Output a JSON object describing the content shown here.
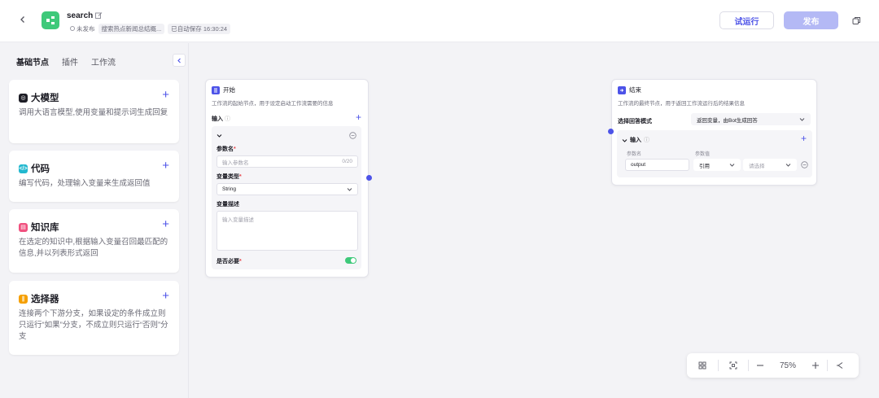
{
  "header": {
    "app_name": "search",
    "status": "未发布",
    "description": "搜索热点新闻总结概...",
    "autosave": "已自动保存 16:30:24",
    "test_run_label": "试运行",
    "publish_label": "发布"
  },
  "sidebar": {
    "tabs": [
      {
        "label": "基础节点"
      },
      {
        "label": "插件"
      },
      {
        "label": "工作流"
      }
    ],
    "nodes": [
      {
        "title": "大模型",
        "desc": "调用大语言模型,使用变量和提示词生成回复",
        "color": "#1d1d25"
      },
      {
        "title": "代码",
        "desc": "编写代码，处理输入变量来生成返回值",
        "color": "#22b8cf"
      },
      {
        "title": "知识库",
        "desc": "在选定的知识中,根据输入变量召回最匹配的信息,并以列表形式返回",
        "color": "#f0517f"
      },
      {
        "title": "选择器",
        "desc": "连接两个下游分支，如果设定的条件成立则只运行“如果”分支，不成立则只运行“否则”分支",
        "color": "#f59f00"
      }
    ]
  },
  "start_node": {
    "title": "开始",
    "desc": "工作流的起始节点，用于设定启动工作流需要的信息",
    "input_label": "输入",
    "param_name_label": "参数名",
    "param_name_placeholder": "输入参数名",
    "param_name_count": "0/20",
    "var_type_label": "变量类型",
    "var_type_value": "String",
    "var_desc_label": "变量描述",
    "var_desc_placeholder": "输入变量描述",
    "required_label": "是否必要"
  },
  "end_node": {
    "title": "结束",
    "desc": "工作流的最终节点，用于返回工作流运行后的结果信息",
    "mode_label": "选择回答模式",
    "mode_value": "返回变量，由Bot生成回答",
    "input_label": "输入",
    "col_param_name": "参数名",
    "col_param_value": "参数值",
    "param_name": "output",
    "ref_label": "引用",
    "select_placeholder": "请选择"
  },
  "zoom": {
    "level": "75%"
  }
}
